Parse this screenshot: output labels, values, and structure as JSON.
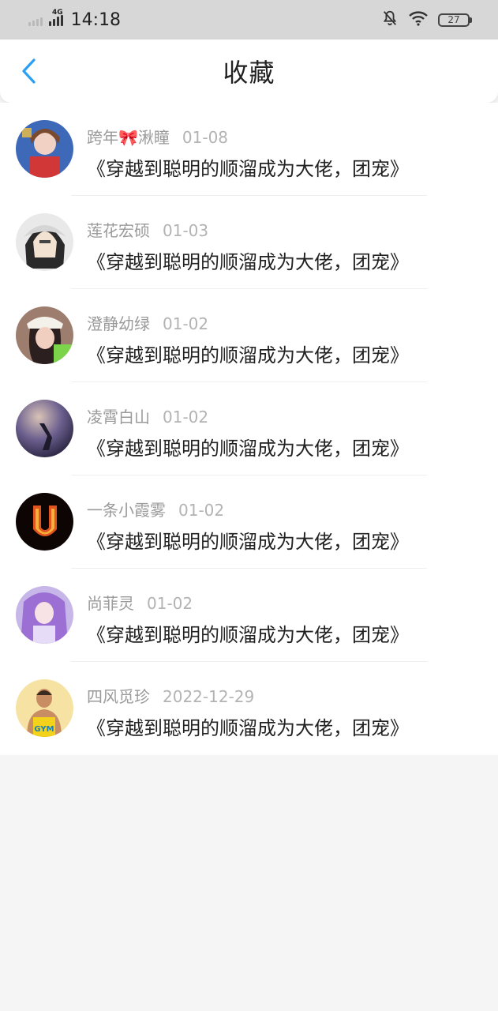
{
  "status_bar": {
    "network": "4G",
    "time": "14:18",
    "battery": "27",
    "icons": [
      "signal-icon",
      "bell-muted-icon",
      "wifi-icon",
      "battery-icon"
    ]
  },
  "header": {
    "title": "收藏",
    "back_icon": "chevron-left-icon",
    "accent_color": "#2a9ff3"
  },
  "favorites": [
    {
      "user": "跨年🎀湫瞳",
      "date": "01-08",
      "text": "《穿越到聪明的顺溜成为大佬，团宠》",
      "avatar_color": "#c03a3a"
    },
    {
      "user": "莲花宏硕",
      "date": "01-03",
      "text": "《穿越到聪明的顺溜成为大佬，团宠》",
      "avatar_color": "#7d7d7d"
    },
    {
      "user": "澄静幼绿",
      "date": "01-02",
      "text": "《穿越到聪明的顺溜成为大佬，团宠》",
      "avatar_color": "#b98f7e"
    },
    {
      "user": "凌霄白山",
      "date": "01-02",
      "text": "《穿越到聪明的顺溜成为大佬，团宠》",
      "avatar_color": "#4b4770"
    },
    {
      "user": "一条小霞雾",
      "date": "01-02",
      "text": "《穿越到聪明的顺溜成为大佬，团宠》",
      "avatar_color": "#1a0b08"
    },
    {
      "user": "尚菲灵",
      "date": "01-02",
      "text": "《穿越到聪明的顺溜成为大佬，团宠》",
      "avatar_color": "#a78ad0"
    },
    {
      "user": "四风觅珍",
      "date": "2022-12-29",
      "text": "《穿越到聪明的顺溜成为大佬，团宠》",
      "avatar_color": "#f3d98a"
    }
  ]
}
